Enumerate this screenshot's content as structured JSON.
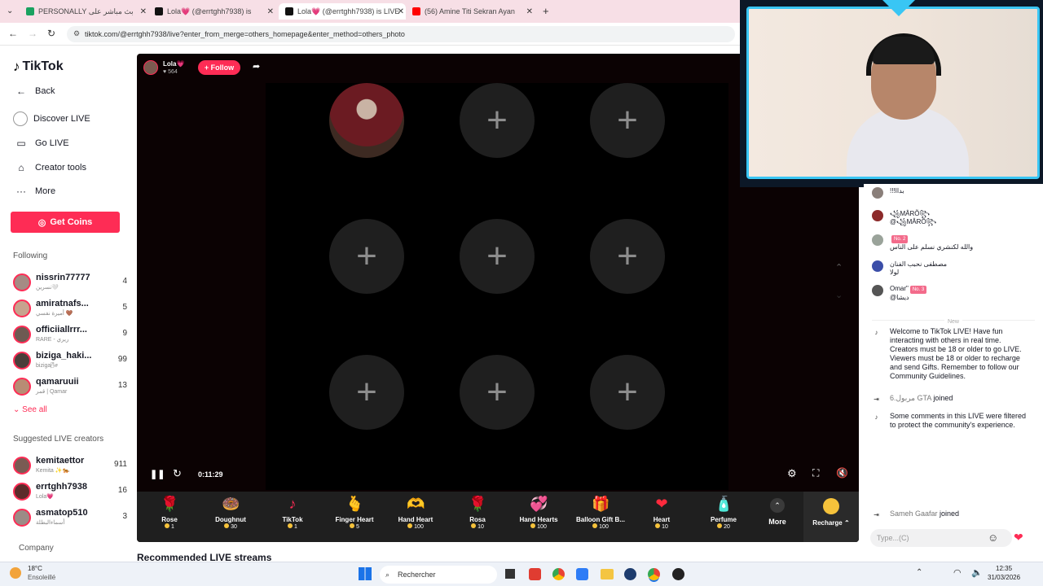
{
  "browser": {
    "tabs": [
      {
        "label": "PERSONALLY بث مباشر على",
        "color": "#1aa260"
      },
      {
        "label": "Lola💗 (@errtghh7938) is",
        "color": "#111111"
      },
      {
        "label": "Lola💗 (@errtghh7938) is LIVE",
        "color": "#111111"
      },
      {
        "label": "(56) Amine Titi Sekran Ayan",
        "color": "#ff0000"
      }
    ],
    "url": "tiktok.com/@errtghh7938/live?enter_from_merge=others_homepage&enter_method=others_photo"
  },
  "nav": {
    "logo": "TikTok",
    "back": "Back",
    "items": [
      {
        "label": "Discover LIVE",
        "icon": "discover-icon"
      },
      {
        "label": "Go LIVE",
        "icon": "camera-icon"
      },
      {
        "label": "Creator tools",
        "icon": "home-icon"
      },
      {
        "label": "More",
        "icon": "more-icon"
      }
    ],
    "get_coins": "Get Coins",
    "following_title": "Following",
    "following": [
      {
        "name": "nissrin77777",
        "sub": "نسرين🤍",
        "count": "4"
      },
      {
        "name": "amiratnafs...",
        "sub": "أميرة نفسي 🤎",
        "count": "5"
      },
      {
        "name": "officiiallrrr...",
        "sub": "RARE - ريري",
        "count": "9"
      },
      {
        "name": "biziga_haki...",
        "sub": "biziga🌬",
        "count": "99"
      },
      {
        "name": "qamaruuii",
        "sub": "قمر | Qamar",
        "count": "13"
      }
    ],
    "see_all": "See all",
    "suggested_title": "Suggested LIVE creators",
    "suggested": [
      {
        "name": "kemitaettor",
        "sub": "Kemita ✨🐅",
        "count": "911"
      },
      {
        "name": "errtghh7938",
        "sub": "Lola💗",
        "count": "16"
      },
      {
        "name": "asmatop510",
        "sub": "أسماءالبطلة",
        "count": "3"
      }
    ],
    "company": "Company"
  },
  "stream": {
    "host_name": "Lola💗",
    "host_likes": "564",
    "follow_label": "+ Follow",
    "elapsed": "0:11:29",
    "recommended": "Recommended LIVE streams"
  },
  "gifts": [
    {
      "name": "Rose",
      "price": "1",
      "glyph": "🌹"
    },
    {
      "name": "Doughnut",
      "price": "30",
      "glyph": "🍩"
    },
    {
      "name": "TikTok",
      "price": "1",
      "glyph": "♪"
    },
    {
      "name": "Finger Heart",
      "price": "5",
      "glyph": "🫰"
    },
    {
      "name": "Hand Heart",
      "price": "100",
      "glyph": "🫶"
    },
    {
      "name": "Rosa",
      "price": "10",
      "glyph": "🌹"
    },
    {
      "name": "Hand Hearts",
      "price": "100",
      "glyph": "💞"
    },
    {
      "name": "Balloon Gift B...",
      "price": "100",
      "glyph": "🎁"
    },
    {
      "name": "Heart",
      "price": "10",
      "glyph": "❤"
    },
    {
      "name": "Perfume",
      "price": "20",
      "glyph": "🧴"
    }
  ],
  "gift_more": "More",
  "recharge": "Recharge",
  "chat": {
    "messages": [
      {
        "name": "",
        "text": "!!!بداا"
      },
      {
        "name": "꧁MÂRÕ꧂",
        "text": "@꧁MÂRÕ꧂"
      },
      {
        "name": "",
        "badge": "No. 2",
        "text": "والله لكنشري نسلم على الناس"
      },
      {
        "name": "مصطفى نحبب الفنان",
        "text": "لولا"
      },
      {
        "name": "Omar\"",
        "badge": "No. 3",
        "text": "@ديشا"
      }
    ],
    "new_label": "New",
    "welcome": "Welcome to TikTok LIVE! Have fun interacting with others in real time. Creators must be 18 or older to go LIVE. Viewers must be 18 or older to recharge and send Gifts. Remember to follow our Community Guidelines.",
    "joined1_name": "6.مربول GTA",
    "joined1_text": "joined",
    "filtered": "Some comments in this LIVE were filtered to protect the community's experience.",
    "joined2_name": "Sameh Gaafar",
    "joined2_text": "joined",
    "input_placeholder": "Type...(C)"
  },
  "taskbar": {
    "weather_temp": "18°C",
    "weather_desc": "Ensoleillé",
    "search": "Rechercher",
    "time": "12:35",
    "date": "31/03/2026"
  }
}
